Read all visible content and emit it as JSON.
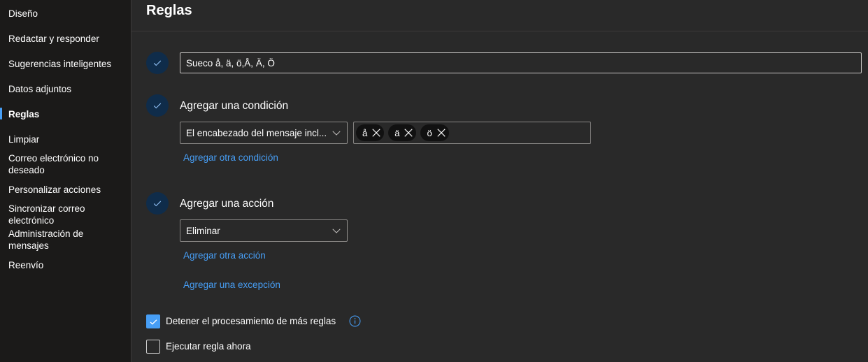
{
  "sidebar": {
    "items": [
      {
        "label": "Diseño"
      },
      {
        "label": "Redactar y responder"
      },
      {
        "label": "Sugerencias inteligentes"
      },
      {
        "label": "Datos adjuntos"
      },
      {
        "label": "Reglas",
        "active": true
      },
      {
        "label": "Limpiar"
      },
      {
        "label": "Correo electrónico no deseado"
      },
      {
        "label": "Personalizar acciones"
      },
      {
        "label": "Sincronizar correo electrónico"
      },
      {
        "label": "Administración de mensajes"
      },
      {
        "label": "Reenvío"
      }
    ]
  },
  "header": {
    "title": "Reglas"
  },
  "rule": {
    "name_value": "Sueco å, ä, ö,Å, Ä, Ö",
    "condition": {
      "heading": "Agregar una condición",
      "dropdown_value": "El encabezado del mensaje incl...",
      "tags": [
        "å",
        "ä",
        "ö"
      ],
      "add_link": "Agregar otra condición"
    },
    "action": {
      "heading": "Agregar una acción",
      "dropdown_value": "Eliminar",
      "add_link": "Agregar otra acción"
    },
    "exception_link": "Agregar una excepción",
    "stop_processing": {
      "label": "Detener el procesamiento de más reglas",
      "checked": true
    },
    "run_now": {
      "label": "Ejecutar regla ahora",
      "checked": false
    }
  },
  "colors": {
    "accent": "#479ef5",
    "sidebar_bg": "#1b1a19",
    "main_bg": "#292929",
    "step_circle": "#0f2c4a"
  },
  "icons": [
    "checkmark-icon",
    "chevron-down-icon",
    "dismiss-icon",
    "info-icon"
  ]
}
